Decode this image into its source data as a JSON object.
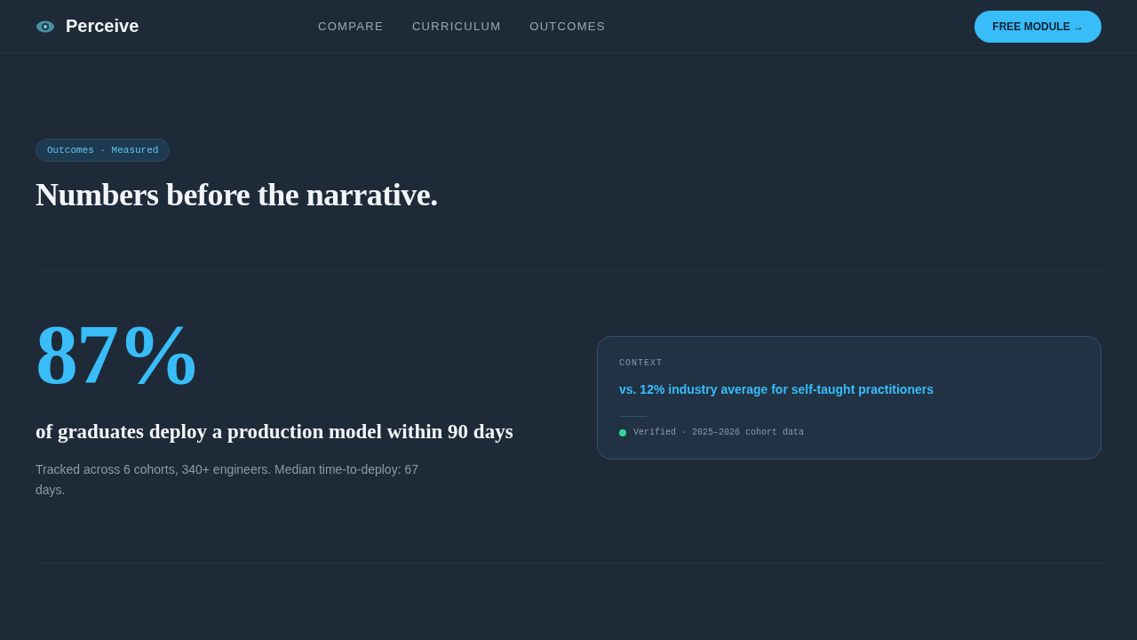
{
  "brand": {
    "name": "Perceive"
  },
  "nav": [
    {
      "label": "COMPARE"
    },
    {
      "label": "CURRICULUM"
    },
    {
      "label": "OUTCOMES"
    }
  ],
  "cta": {
    "label": "FREE MODULE →"
  },
  "hero": {
    "badge": "Outcomes · Measured",
    "title": "Numbers before the narrative."
  },
  "stats": [
    {
      "value": "87%",
      "headline": "of graduates deploy a production model within 90 days",
      "detail": "Tracked across 6 cohorts, 340+ engineers. Median time-to-deploy: 67 days.",
      "context_label": "CONTEXT",
      "context": "vs. 12% industry average for self-taught practitioners",
      "note": "Verified · 2025–2026 cohort data"
    }
  ]
}
